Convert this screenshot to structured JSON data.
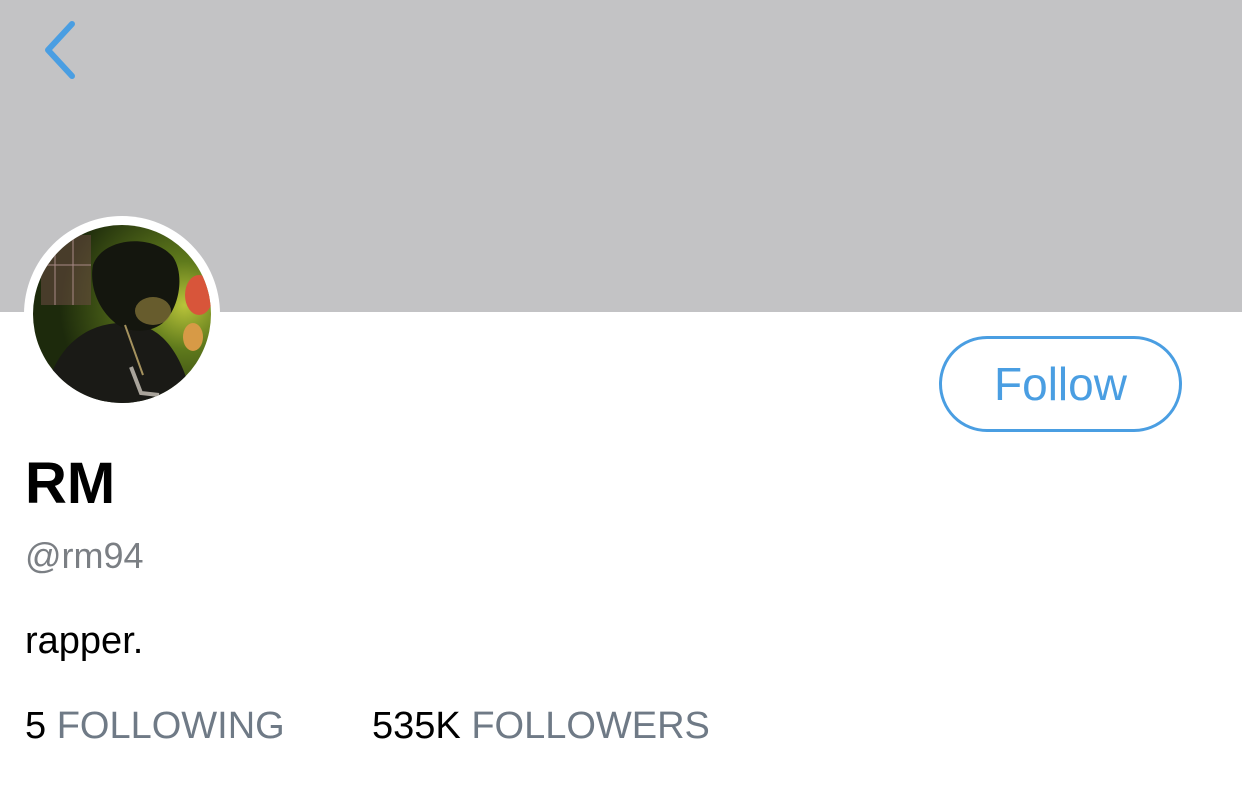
{
  "header": {
    "banner_color": "#c3c3c5",
    "back_icon": "chevron-left-icon",
    "accent_color": "#4a9ee2"
  },
  "profile": {
    "display_name": "RM",
    "handle": "@rm94",
    "bio": "rapper.",
    "follow_label": "Follow"
  },
  "stats": {
    "following": {
      "count": "5",
      "label": "FOLLOWING"
    },
    "followers": {
      "count": "535K",
      "label": "FOLLOWERS"
    }
  }
}
